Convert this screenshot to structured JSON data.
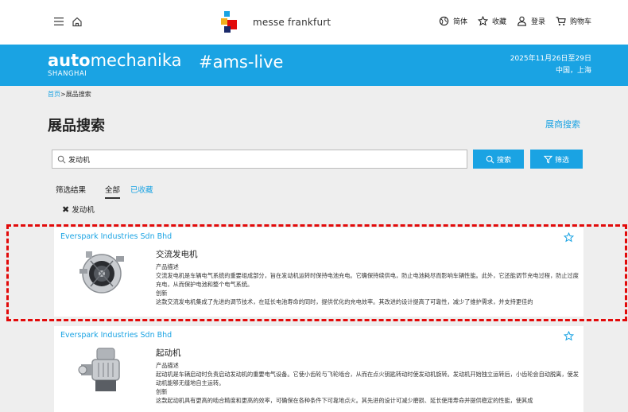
{
  "topbar": {
    "brand_name": "messe frankfurt",
    "language_label": "简体",
    "favorites_label": "收藏",
    "login_label": "登录",
    "cart_label": "购物车"
  },
  "banner": {
    "logo_bold": "auto",
    "logo_light": "mechanika",
    "logo_sub": "SHANGHAI",
    "hashtag": "#ams-live",
    "date": "2025年11月26日至29日",
    "place": "中国，上海"
  },
  "breadcrumb": {
    "home": "首页",
    "separator": ">",
    "current": "展品搜索"
  },
  "page_title": "展品搜索",
  "exhibitor_search_link": "展商搜索",
  "search": {
    "value": "发动机",
    "search_button": "搜索",
    "filter_button": "筛选"
  },
  "filters": {
    "result_label": "筛选结果",
    "tab_all": "全部",
    "tab_favorites": "已收藏",
    "active_chip": "发动机"
  },
  "cards": [
    {
      "company": "Everspark Industries Sdn Bhd",
      "product": "交流发电机",
      "desc_label": "产品描述",
      "desc_text": "交流发电机是车辆电气系统的重要组成部分，旨在发动机运转时保持电池充电。它确保持续供电，防止电池耗尽而影响车辆性能。此外，它还能调节充电过程，防止过度充电，从而保护电池和整个电气系统。",
      "innov_label": "创新",
      "innov_text": "这款交流发电机集成了先进的调节技术，在延长电池寿命的同时，提供优化的充电效率。其改进的设计提高了可靠性，减少了维护需求，并支持更佳的"
    },
    {
      "company": "Everspark Industries Sdn Bhd",
      "product": "起动机",
      "desc_label": "产品描述",
      "desc_text": "起动机是车辆启动时负责启动发动机的重要电气设备。它使小齿轮与飞轮啮合，从而在点火钥匙转动时使发动机旋转。发动机开始独立运转后，小齿轮会自动脱离，使发动机能够无缝地自主运转。",
      "innov_label": "创新",
      "innov_text": "这款起动机具有更高的啮合精度和更高的效率，可确保在各种条件下可靠地点火。其先进的设计可减少磨损、延长使用寿命并提供稳定的性能，使其成"
    }
  ],
  "colors": {
    "accent": "#1aa3e3",
    "highlight": "#e20a0a",
    "background": "#eeeeee"
  }
}
